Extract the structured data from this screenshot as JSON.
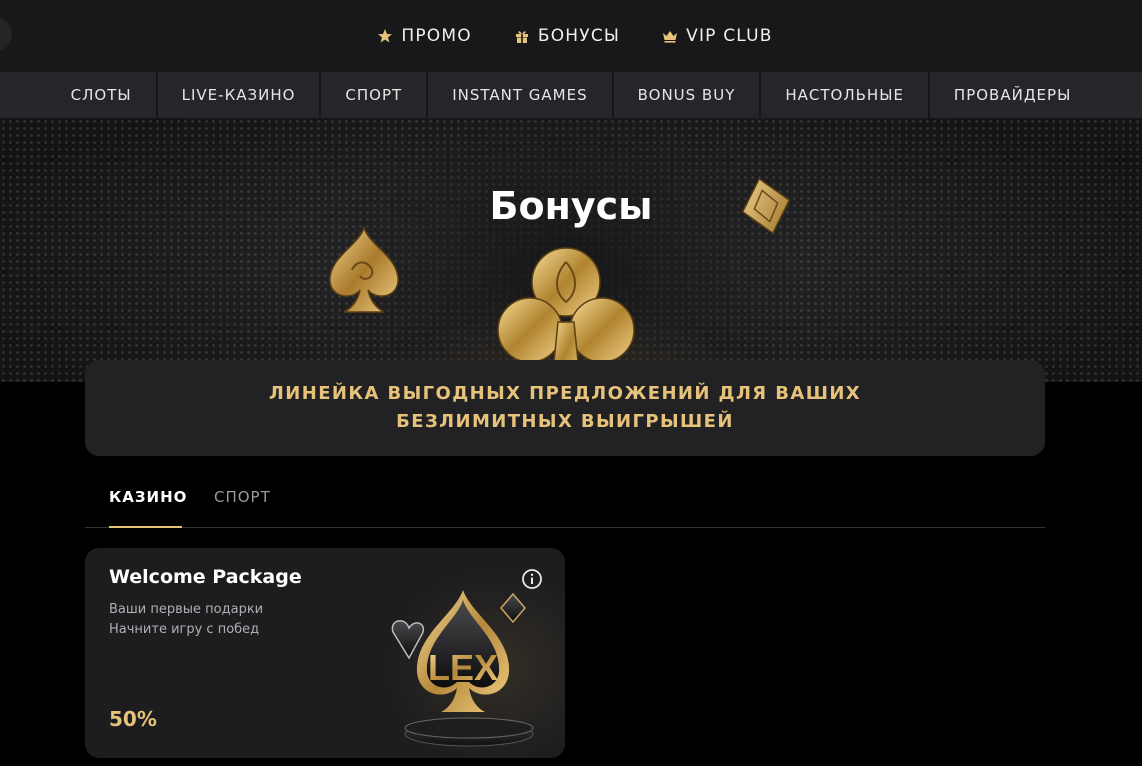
{
  "top_nav": [
    {
      "label": "ПРОМО",
      "icon": "star-icon"
    },
    {
      "label": "БОНУСЫ",
      "icon": "gift-icon"
    },
    {
      "label": "VIP CLUB",
      "icon": "crown-icon"
    }
  ],
  "categories": [
    "СЛОТЫ",
    "LIVE-КАЗИНО",
    "СПОРТ",
    "INSTANT GAMES",
    "BONUS BUY",
    "НАСТОЛЬНЫЕ",
    "ПРОВАЙДЕРЫ"
  ],
  "hero": {
    "title": "Бонусы"
  },
  "banner": {
    "text": "ЛИНЕЙКА ВЫГОДНЫХ ПРЕДЛОЖЕНИЙ ДЛЯ ВАШИХ БЕЗЛИМИТНЫХ ВЫИГРЫШЕЙ"
  },
  "tabs": {
    "active": "КАЗИНО",
    "inactive": "СПОРТ"
  },
  "card": {
    "title": "Welcome Package",
    "subtitle_1": "Ваши первые подарки",
    "subtitle_2": "Начните игру с побед",
    "percent": "50%",
    "logo_text": "LEX"
  },
  "colors": {
    "accent_gold": "#e6c27a",
    "background": "#000000",
    "panel": "#222224"
  }
}
